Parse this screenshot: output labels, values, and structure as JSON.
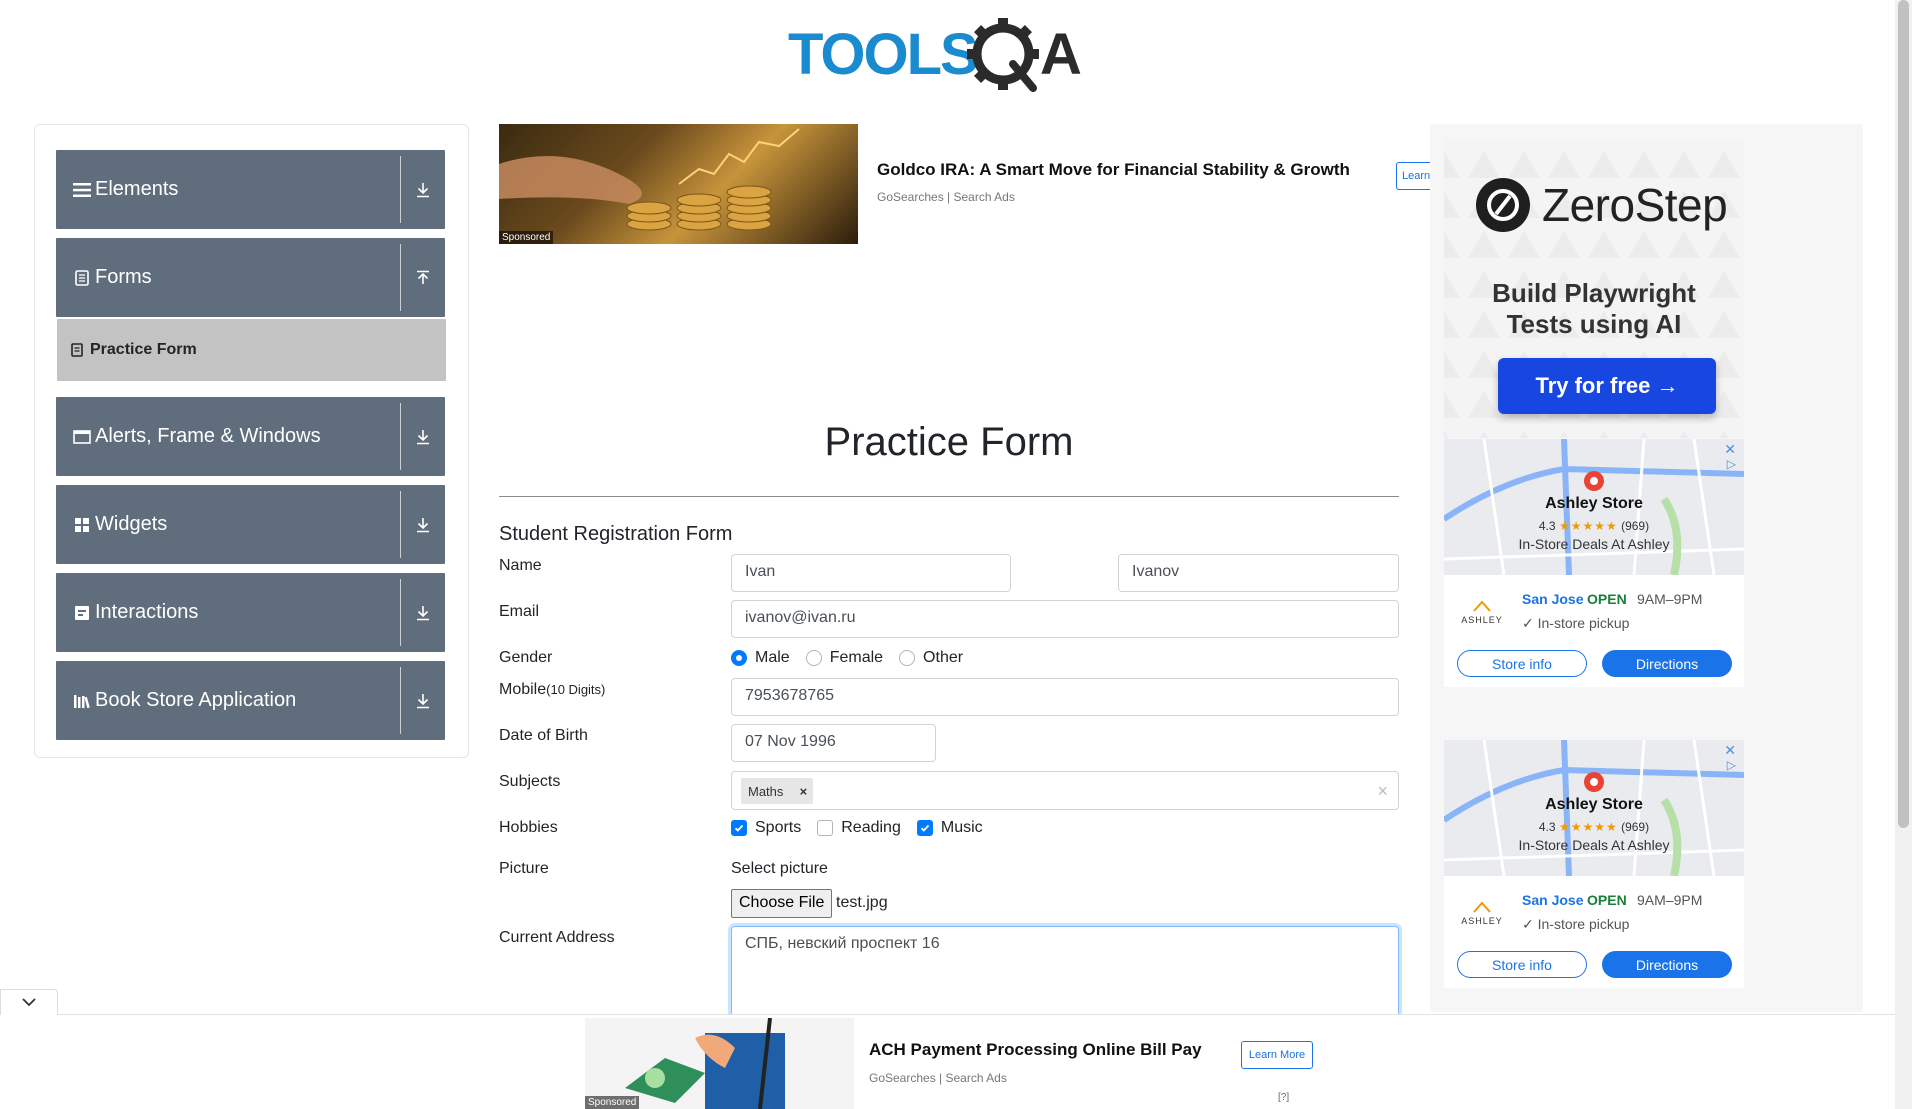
{
  "header": {
    "logo_text": "TOOLSQA"
  },
  "sidebar": {
    "groups": [
      {
        "label": "Elements",
        "icon": "hamburger-icon",
        "toggle": "download-arrow-icon"
      },
      {
        "label": "Forms",
        "icon": "document-icon",
        "toggle": "upload-arrow-icon"
      },
      {
        "label": "Alerts, Frame & Windows",
        "icon": "window-icon",
        "toggle": "download-arrow-icon"
      },
      {
        "label": "Widgets",
        "icon": "grid-icon",
        "toggle": "download-arrow-icon"
      },
      {
        "label": "Interactions",
        "icon": "interaction-icon",
        "toggle": "download-arrow-icon"
      },
      {
        "label": "Book Store Application",
        "icon": "books-icon",
        "toggle": "download-arrow-icon"
      }
    ],
    "active_item": "Practice Form"
  },
  "ad_top": {
    "title": "Goldco IRA: A Smart Move for Financial Stability & Growth",
    "source": "GoSearches | Search Ads",
    "sponsored": "Sponsored",
    "button": "Learn"
  },
  "form": {
    "page_title": "Practice Form",
    "subtitle": "Student Registration Form",
    "labels": {
      "name": "Name",
      "email": "Email",
      "gender": "Gender",
      "mobile": "Mobile",
      "mobile_hint": "(10 Digits)",
      "dob": "Date of Birth",
      "subjects": "Subjects",
      "hobbies": "Hobbies",
      "picture": "Picture",
      "address": "Current Address"
    },
    "first_name": "Ivan",
    "last_name": "Ivanov",
    "email": "ivanov@ivan.ru",
    "gender_options": [
      "Male",
      "Female",
      "Other"
    ],
    "gender_selected": "Male",
    "mobile": "7953678765",
    "dob": "07 Nov 1996",
    "subjects": [
      "Maths"
    ],
    "subject_remove": "×",
    "subjects_clear": "×",
    "hobbies": [
      {
        "label": "Sports",
        "checked": true
      },
      {
        "label": "Reading",
        "checked": false
      },
      {
        "label": "Music",
        "checked": true
      }
    ],
    "picture_label": "Select picture",
    "file_button": "Choose File",
    "file_name": "test.jpg",
    "address": "СПБ, невский проспект 16"
  },
  "ad_right": {
    "brand": "ZeroStep",
    "tagline_1": "Build Playwright",
    "tagline_2": "Tests using AI",
    "cta": "Try for free →",
    "store_ads": [
      {
        "store": "Ashley Store",
        "rating": "4.3",
        "stars": "★★★★★",
        "reviews": "(969)",
        "deal": "In-Store Deals At Ashley",
        "city": "San Jose",
        "open": "OPEN",
        "hours": "9AM–9PM",
        "pickup": "✓ In-store pickup",
        "logo": "ASHLEY",
        "info_btn": "Store info",
        "dir_btn": "Directions",
        "close": "✕",
        "choice": "▷"
      },
      {
        "store": "Ashley Store",
        "rating": "4.3",
        "stars": "★★★★★",
        "reviews": "(969)",
        "deal": "In-Store Deals At Ashley",
        "city": "San Jose",
        "open": "OPEN",
        "hours": "9AM–9PM",
        "pickup": "✓ In-store pickup",
        "logo": "ASHLEY",
        "info_btn": "Store info",
        "dir_btn": "Directions",
        "close": "✕",
        "choice": "▷"
      }
    ]
  },
  "ad_bottom": {
    "title": "ACH Payment Processing Online Bill Pay",
    "source": "GoSearches | Search Ads",
    "button": "Learn More",
    "sponsored": "Sponsored",
    "choices": "[?]"
  },
  "colors": {
    "accent": "#007bff",
    "sidebar_group": "#5f6d7c",
    "active_item": "#c3c3c3",
    "logo_blue": "#1b8bd0",
    "logo_dark": "#2b2b2b"
  }
}
